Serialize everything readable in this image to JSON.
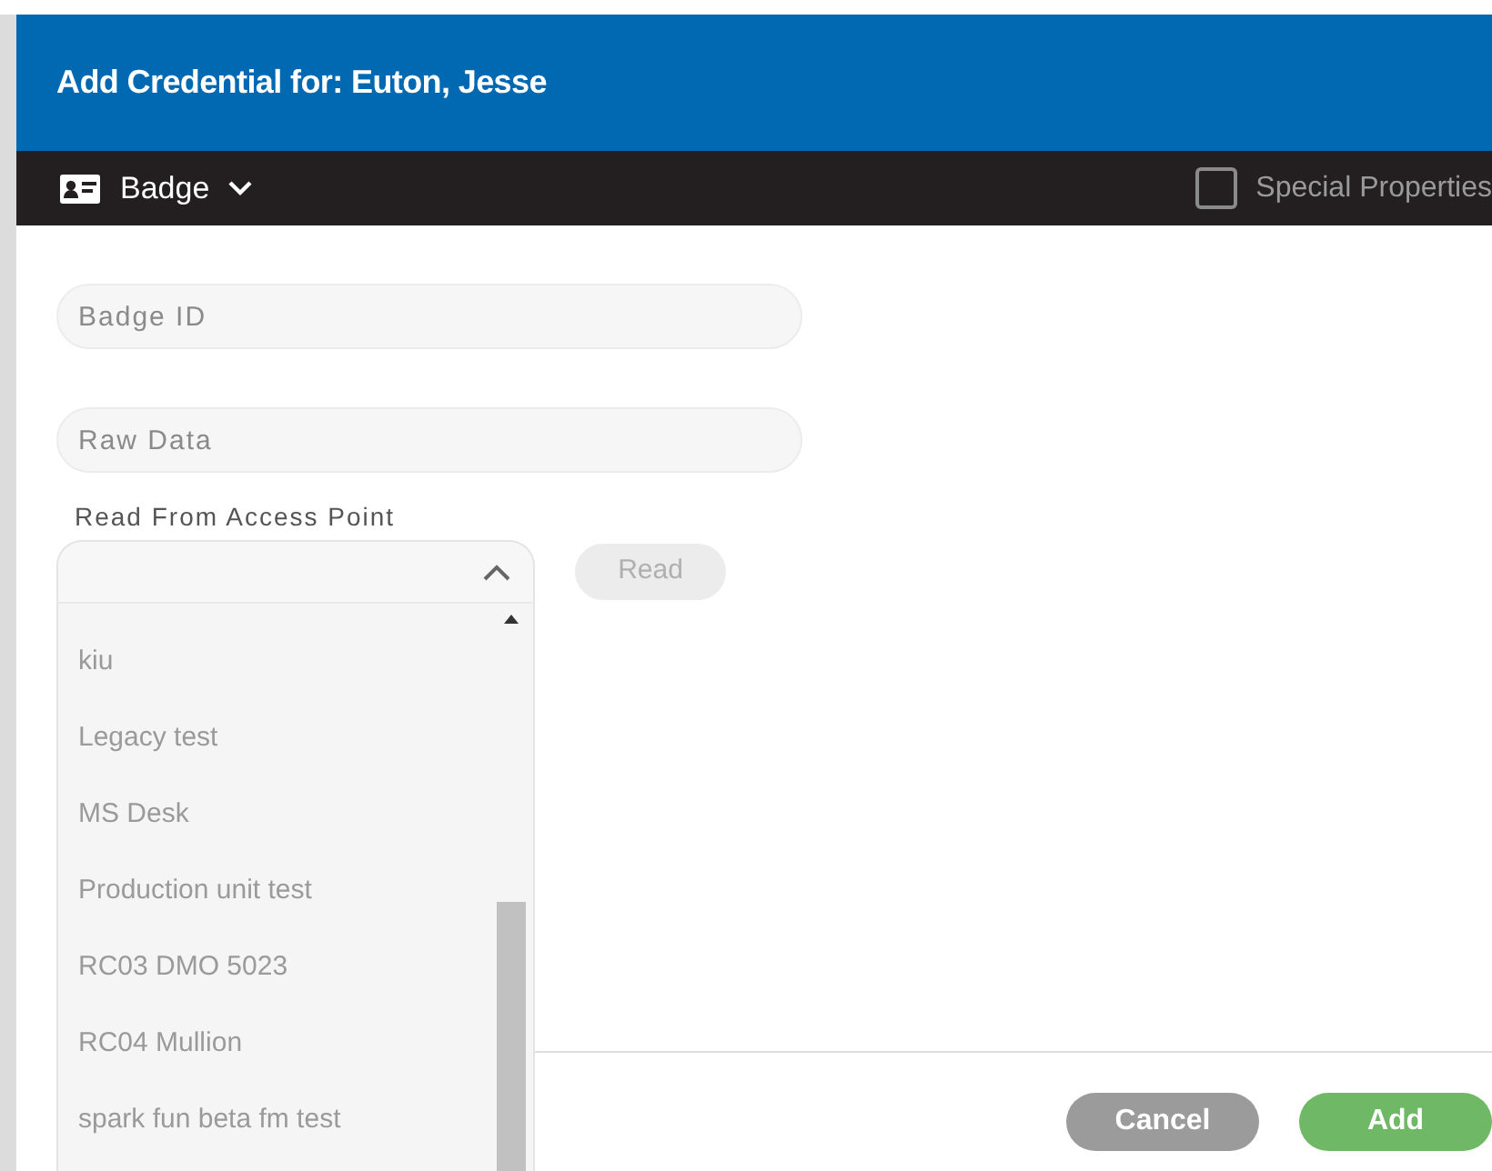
{
  "dialog": {
    "title": "Add Credential for: Euton, Jesse"
  },
  "toolbar": {
    "type_label": "Badge",
    "special_properties": {
      "label": "Special Properties",
      "checked": false
    }
  },
  "fields": [
    {
      "placeholder": "Badge ID"
    },
    {
      "placeholder": "Raw Data"
    }
  ],
  "access_point": {
    "label": "Read From Access Point",
    "expanded": true,
    "options": [
      "kiu",
      "Legacy test",
      "MS Desk",
      "Production unit test",
      "RC03 DMO 5023",
      "RC04 Mullion",
      "spark fun beta fm test"
    ],
    "read_button": {
      "label": "Read",
      "disabled": true
    }
  },
  "buttons": [
    {
      "label": "Cancel",
      "kind": "secondary"
    },
    {
      "label": "Add",
      "kind": "primary"
    }
  ]
}
